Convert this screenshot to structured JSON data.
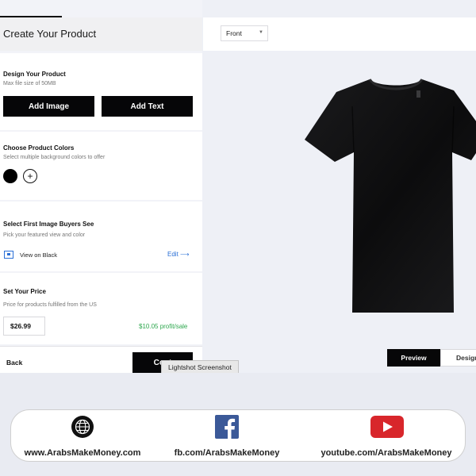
{
  "panel": {
    "title": "Create Your Product"
  },
  "design": {
    "title": "Design Your Product",
    "subtitle": "Max file size of 50MB",
    "add_image_label": "Add Image",
    "add_text_label": "Add Text"
  },
  "colors": {
    "title": "Choose Product Colors",
    "subtitle": "Select multiple background colors to offer",
    "selected": [
      "#000000"
    ],
    "add_symbol": "+"
  },
  "featured": {
    "title": "Select First Image Buyers See",
    "subtitle": "Pick your featured view and color",
    "view_label": "View on Black",
    "edit_label": "Edit ⟶"
  },
  "price": {
    "title": "Set Your Price",
    "subtitle": "Price for products fulfilled from the US",
    "value": "$26.99",
    "profit": "$10.05 profit/sale"
  },
  "bottom": {
    "back_label": "Back",
    "continue_label": "Cont"
  },
  "tooltip": "Lightshot Screenshot",
  "view_select": {
    "value": "Front"
  },
  "preview_tabs": {
    "preview_label": "Preview",
    "design_label": "Design"
  },
  "footer": {
    "website": "www.ArabsMakeMoney.com",
    "facebook": "fb.com/ArabsMakeMoney",
    "youtube": "youtube.com/ArabsMakeMoney"
  },
  "theme": {
    "accent": "#2a6fd6",
    "profit_color": "#2fa84f",
    "button": "#060608"
  }
}
